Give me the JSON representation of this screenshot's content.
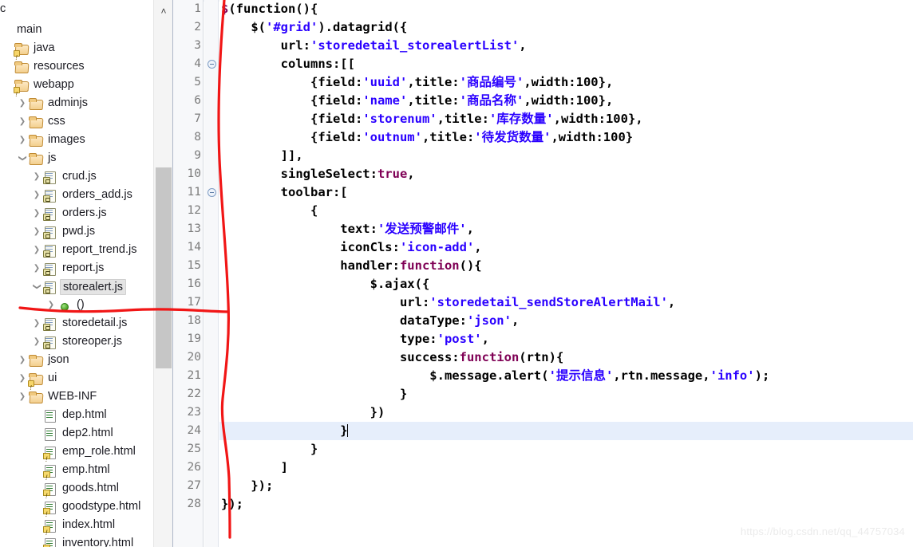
{
  "explorer": {
    "name": "package-explorer",
    "clipped_top_text": "c",
    "items": [
      {
        "label": "main",
        "icon": "none",
        "twist": "none",
        "indent": 0,
        "selected": false
      },
      {
        "label": "java",
        "icon": "folder-deco",
        "twist": "none",
        "indent": 0,
        "selected": false
      },
      {
        "label": "resources",
        "icon": "folder",
        "twist": "none",
        "indent": 0,
        "selected": false
      },
      {
        "label": "webapp",
        "icon": "folder-deco",
        "twist": "none",
        "indent": 0,
        "selected": false
      },
      {
        "label": "adminjs",
        "icon": "folder",
        "twist": "right",
        "indent": 1,
        "selected": false
      },
      {
        "label": "css",
        "icon": "folder",
        "twist": "right",
        "indent": 1,
        "selected": false
      },
      {
        "label": "images",
        "icon": "folder",
        "twist": "right",
        "indent": 1,
        "selected": false
      },
      {
        "label": "js",
        "icon": "folder",
        "twist": "down",
        "indent": 1,
        "selected": false
      },
      {
        "label": "crud.js",
        "icon": "js",
        "twist": "right",
        "indent": 2,
        "selected": false
      },
      {
        "label": "orders_add.js",
        "icon": "js",
        "twist": "right",
        "indent": 2,
        "selected": false
      },
      {
        "label": "orders.js",
        "icon": "js",
        "twist": "right",
        "indent": 2,
        "selected": false
      },
      {
        "label": "pwd.js",
        "icon": "js",
        "twist": "right",
        "indent": 2,
        "selected": false
      },
      {
        "label": "report_trend.js",
        "icon": "js",
        "twist": "right",
        "indent": 2,
        "selected": false
      },
      {
        "label": "report.js",
        "icon": "js",
        "twist": "right",
        "indent": 2,
        "selected": false
      },
      {
        "label": "storealert.js",
        "icon": "js",
        "twist": "down",
        "indent": 2,
        "selected": true
      },
      {
        "label": "()",
        "icon": "green-dot",
        "twist": "right",
        "indent": 3,
        "selected": false
      },
      {
        "label": "storedetail.js",
        "icon": "js",
        "twist": "right",
        "indent": 2,
        "selected": false
      },
      {
        "label": "storeoper.js",
        "icon": "js",
        "twist": "right",
        "indent": 2,
        "selected": false
      },
      {
        "label": "json",
        "icon": "folder",
        "twist": "right",
        "indent": 1,
        "selected": false
      },
      {
        "label": "ui",
        "icon": "folder-deco",
        "twist": "right",
        "indent": 1,
        "selected": false
      },
      {
        "label": "WEB-INF",
        "icon": "folder",
        "twist": "right",
        "indent": 1,
        "selected": false
      },
      {
        "label": "dep.html",
        "icon": "html",
        "twist": "none",
        "indent": 2,
        "selected": false
      },
      {
        "label": "dep2.html",
        "icon": "html",
        "twist": "none",
        "indent": 2,
        "selected": false
      },
      {
        "label": "emp_role.html",
        "icon": "html-warn",
        "twist": "none",
        "indent": 2,
        "selected": false
      },
      {
        "label": "emp.html",
        "icon": "html-warn",
        "twist": "none",
        "indent": 2,
        "selected": false
      },
      {
        "label": "goods.html",
        "icon": "html-warn",
        "twist": "none",
        "indent": 2,
        "selected": false
      },
      {
        "label": "goodstype.html",
        "icon": "html-warn",
        "twist": "none",
        "indent": 2,
        "selected": false
      },
      {
        "label": "index.html",
        "icon": "html-warn",
        "twist": "none",
        "indent": 2,
        "selected": false
      },
      {
        "label": "inventory.html",
        "icon": "html-warn",
        "twist": "none",
        "indent": 2,
        "selected": false
      }
    ],
    "scrollbar": {
      "up_arrow": "˄"
    }
  },
  "editor": {
    "current_line": 24,
    "fold_lines": [
      4,
      11
    ],
    "lines": [
      {
        "n": 1,
        "html": "<span class=\"s-kw\">$</span>(function(){"
      },
      {
        "n": 2,
        "html": "    $(<span class=\"s-str\">'#grid'</span>).datagrid({"
      },
      {
        "n": 3,
        "html": "        url:<span class=\"s-str\">'storedetail_storealertList'</span>,"
      },
      {
        "n": 4,
        "html": "        columns:[["
      },
      {
        "n": 5,
        "html": "            {field:<span class=\"s-str\">'uuid'</span>,title:<span class=\"s-str\">'商品编号'</span>,width:100},"
      },
      {
        "n": 6,
        "html": "            {field:<span class=\"s-str\">'name'</span>,title:<span class=\"s-str\">'商品名称'</span>,width:100},"
      },
      {
        "n": 7,
        "html": "            {field:<span class=\"s-str\">'storenum'</span>,title:<span class=\"s-str\">'库存数量'</span>,width:100},"
      },
      {
        "n": 8,
        "html": "            {field:<span class=\"s-str\">'outnum'</span>,title:<span class=\"s-str\">'待发货数量'</span>,width:100}"
      },
      {
        "n": 9,
        "html": "        ]],"
      },
      {
        "n": 10,
        "html": "        singleSelect:<span class=\"s-kw\">true</span>,"
      },
      {
        "n": 11,
        "html": "        toolbar:["
      },
      {
        "n": 12,
        "html": "            {"
      },
      {
        "n": 13,
        "html": "                text:<span class=\"s-str\">'发送预警邮件'</span>,"
      },
      {
        "n": 14,
        "html": "                iconCls:<span class=\"s-str\">'icon-add'</span>,"
      },
      {
        "n": 15,
        "html": "                handler:<span class=\"s-kw\">function</span>(){"
      },
      {
        "n": 16,
        "html": "                    $.ajax({"
      },
      {
        "n": 17,
        "html": "                        url:<span class=\"s-str\">'storedetail_sendStoreAlertMail'</span>,"
      },
      {
        "n": 18,
        "html": "                        dataType:<span class=\"s-str\">'json'</span>,"
      },
      {
        "n": 19,
        "html": "                        type:<span class=\"s-str\">'post'</span>,"
      },
      {
        "n": 20,
        "html": "                        success:<span class=\"s-kw\">function</span>(rtn){"
      },
      {
        "n": 21,
        "html": "                            $.message.alert(<span class=\"s-str\">'提示信息'</span>,rtn.message,<span class=\"s-str\">'info'</span>);"
      },
      {
        "n": 22,
        "html": "                        }"
      },
      {
        "n": 23,
        "html": "                    })"
      },
      {
        "n": 24,
        "html": "                }<span class=\"caret\"></span>"
      },
      {
        "n": 25,
        "html": "            }"
      },
      {
        "n": 26,
        "html": "        ]"
      },
      {
        "n": 27,
        "html": "    });"
      },
      {
        "n": 28,
        "html": "});"
      }
    ]
  },
  "annotation": {
    "color": "#f11616",
    "description": "hand-drawn red line"
  },
  "watermark": {
    "text": "https://blog.csdn.net/qq_44757034"
  },
  "colors": {
    "string": "#2a00ff",
    "keyword": "#7f0055",
    "current_line": "#e6eefb",
    "selection": "#e4e4e4",
    "annotation_red": "#f11616",
    "gutter_bg": "#f7f8fa",
    "line_number": "#7b7b7b"
  }
}
